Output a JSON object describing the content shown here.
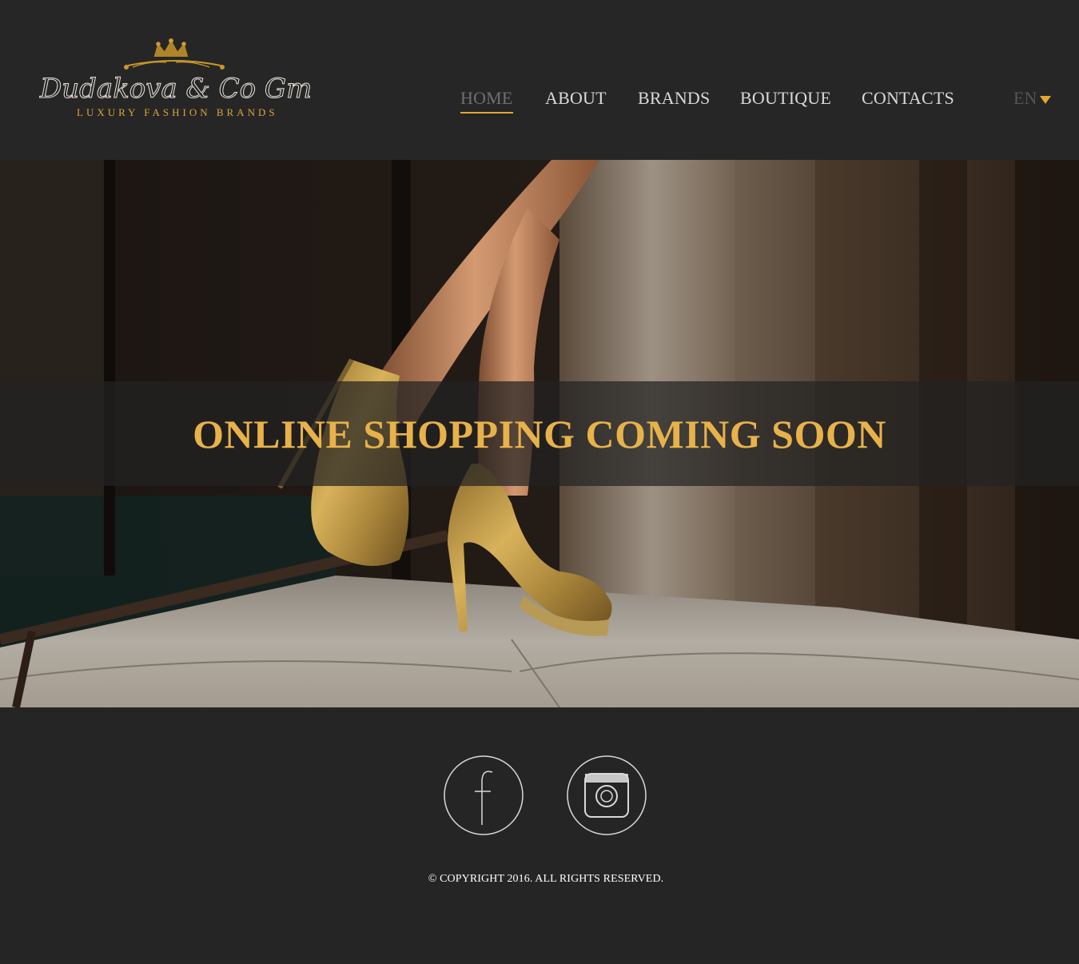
{
  "brand": {
    "name": "Dudakova & Co GmbH",
    "tagline": "LUXURY FASHION BRANDS",
    "logo_icon": "crown-icon"
  },
  "colors": {
    "background": "#262626",
    "accent_gold": "#e2a82f",
    "banner_text": "#e8b24a",
    "nav_text": "#d9d9d9",
    "nav_active": "#6f6f6f"
  },
  "nav": {
    "items": [
      {
        "label": "HOME",
        "active": true
      },
      {
        "label": "ABOUT",
        "active": false
      },
      {
        "label": "BRANDS",
        "active": false
      },
      {
        "label": "BOUTIQUE",
        "active": false
      },
      {
        "label": "CONTACTS",
        "active": false
      }
    ],
    "language": {
      "selected": "EN",
      "icon": "caret-down-icon"
    }
  },
  "hero": {
    "image": "legs in gold glitter platform high heels stepping on stone floor",
    "banner_text": "ONLINE SHOPPING COMING SOON"
  },
  "social": [
    {
      "name": "facebook",
      "icon": "facebook-icon"
    },
    {
      "name": "instagram",
      "icon": "instagram-icon"
    }
  ],
  "footer": {
    "copyright": "© COPYRIGHT 2016. ALL RIGHTS RESERVED."
  }
}
